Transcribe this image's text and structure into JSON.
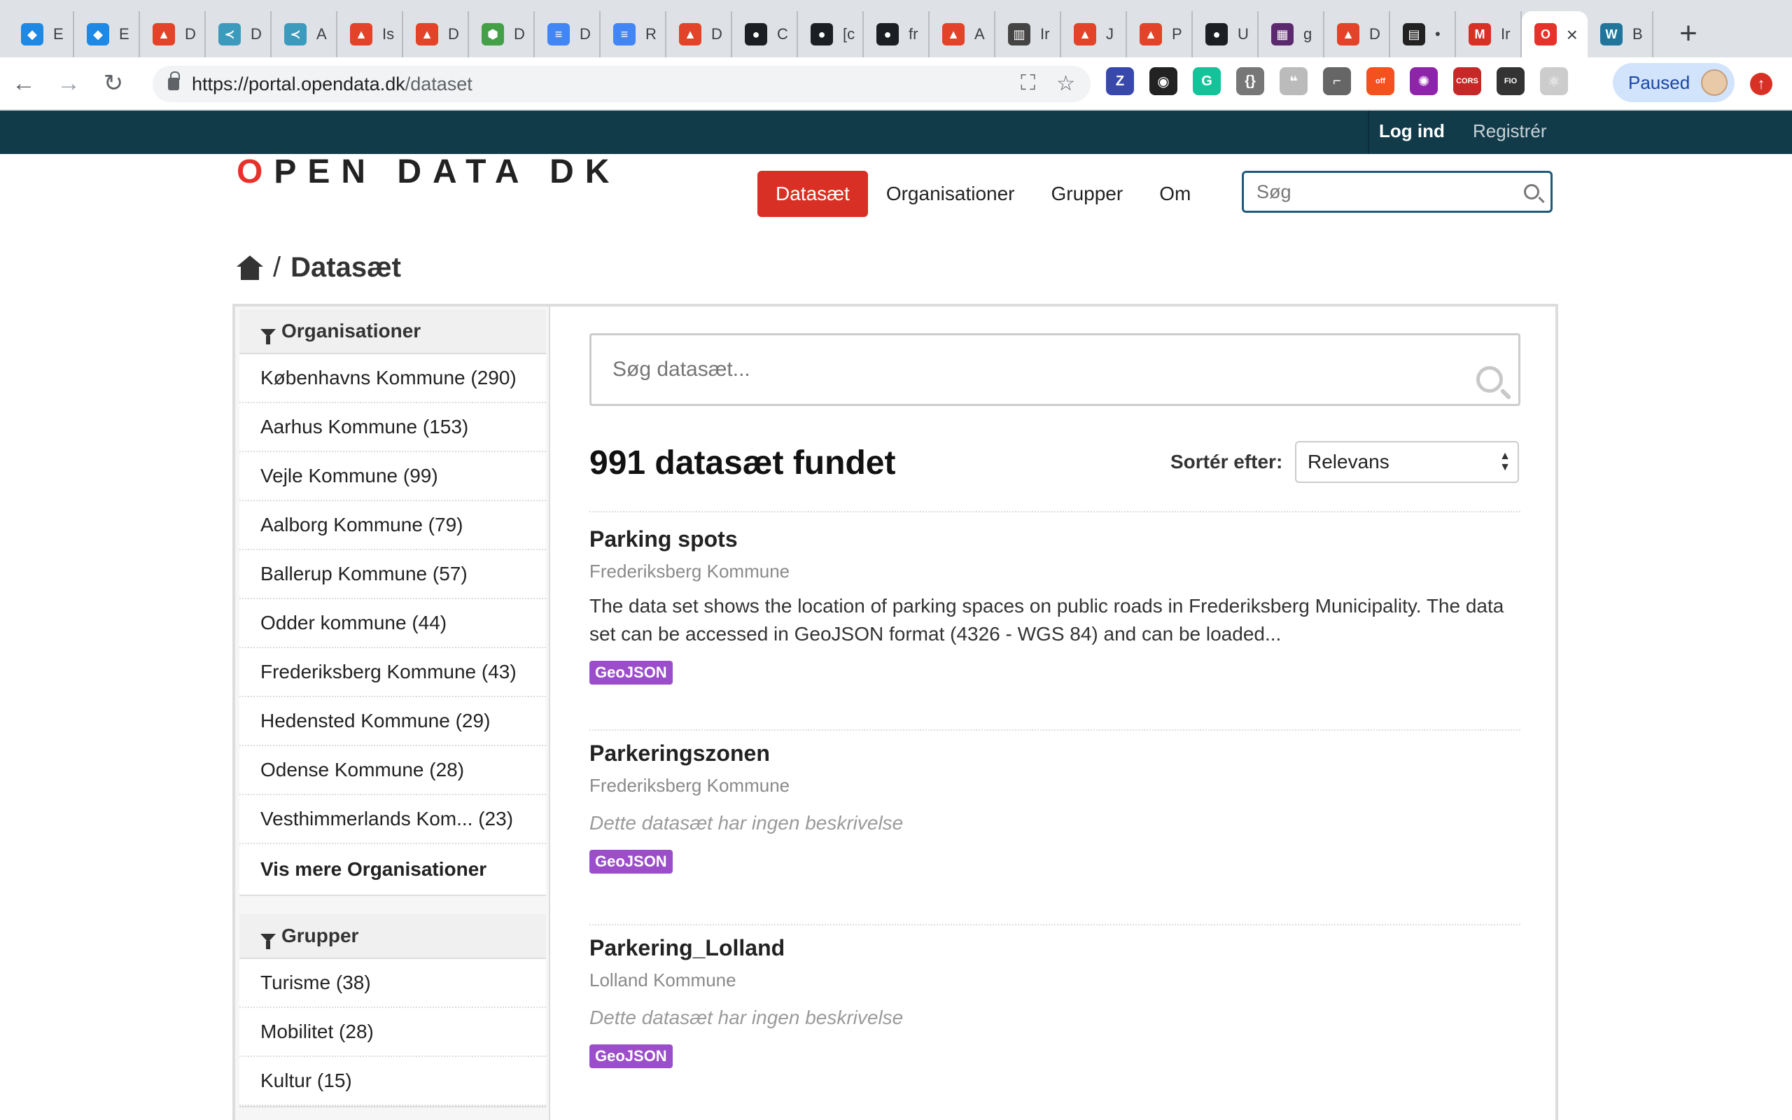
{
  "browser": {
    "tabs": [
      {
        "icon": "vscode-icon",
        "title": "E",
        "color": "#1e88e5",
        "glyph": "◆"
      },
      {
        "icon": "vscode-icon",
        "title": "E",
        "color": "#1e88e5",
        "glyph": "◆"
      },
      {
        "icon": "gitlab-icon",
        "title": "D",
        "color": "#e24329",
        "glyph": "▲"
      },
      {
        "icon": "kite-icon",
        "title": "D",
        "color": "#3c9bbd",
        "glyph": "≺"
      },
      {
        "icon": "kite-icon",
        "title": "A",
        "color": "#3c9bbd",
        "glyph": "≺"
      },
      {
        "icon": "gitlab-icon",
        "title": "Is",
        "color": "#e24329",
        "glyph": "▲"
      },
      {
        "icon": "gitlab-icon",
        "title": "D",
        "color": "#e24329",
        "glyph": "▲"
      },
      {
        "icon": "node-icon",
        "title": "D",
        "color": "#43a047",
        "glyph": "⬢"
      },
      {
        "icon": "google-docs-icon",
        "title": "D",
        "color": "#4285f4",
        "glyph": "≡"
      },
      {
        "icon": "google-docs-icon",
        "title": "R",
        "color": "#4285f4",
        "glyph": "≡"
      },
      {
        "icon": "gitlab-icon",
        "title": "D",
        "color": "#e24329",
        "glyph": "▲"
      },
      {
        "icon": "github-icon",
        "title": "C",
        "color": "#1b1f23",
        "glyph": "●"
      },
      {
        "icon": "github-icon",
        "title": "[c",
        "color": "#1b1f23",
        "glyph": "●"
      },
      {
        "icon": "github-icon",
        "title": "fr",
        "color": "#1b1f23",
        "glyph": "●"
      },
      {
        "icon": "gitlab-icon",
        "title": "A",
        "color": "#e24329",
        "glyph": "▲"
      },
      {
        "icon": "reader-icon",
        "title": "Ir",
        "color": "#444444",
        "glyph": "▥"
      },
      {
        "icon": "gitlab-icon",
        "title": "J",
        "color": "#e24329",
        "glyph": "▲"
      },
      {
        "icon": "gitlab-icon",
        "title": "P",
        "color": "#e24329",
        "glyph": "▲"
      },
      {
        "icon": "github-icon",
        "title": "U",
        "color": "#1b1f23",
        "glyph": "●"
      },
      {
        "icon": "grid-app-icon",
        "title": "g",
        "color": "#5b2a6e",
        "glyph": "▦"
      },
      {
        "icon": "gitlab-icon",
        "title": "D",
        "color": "#e24329",
        "glyph": "▲"
      },
      {
        "icon": "document-icon",
        "title": "•",
        "color": "#222222",
        "glyph": "▤"
      },
      {
        "icon": "gmail-icon",
        "title": "Ir",
        "color": "#d93025",
        "glyph": "M"
      },
      {
        "icon": "opendata-icon",
        "title": "",
        "color": "#e7312b",
        "glyph": "O",
        "active": true
      },
      {
        "icon": "wordpress-icon",
        "title": "B",
        "color": "#21759b",
        "glyph": "W"
      }
    ],
    "address": {
      "origin": "https://portal.opendata.dk",
      "path": "/dataset"
    },
    "extensions": [
      {
        "icon": "z-extension-icon",
        "color": "#3949ab",
        "glyph": "Z"
      },
      {
        "icon": "camera-extension-icon",
        "color": "#222222",
        "glyph": "◉"
      },
      {
        "icon": "grammarly-icon",
        "color": "#15c39a",
        "glyph": "G"
      },
      {
        "icon": "json-extension-icon",
        "color": "#777777",
        "glyph": "{}"
      },
      {
        "icon": "chat-extension-icon",
        "color": "#bbbbbb",
        "glyph": "❝"
      },
      {
        "icon": "paint-roller-icon",
        "color": "#666666",
        "glyph": "⌐"
      },
      {
        "icon": "off-extension-icon",
        "color": "#f4511e",
        "glyph": "off"
      },
      {
        "icon": "color-wheel-icon",
        "color": "#8e24aa",
        "glyph": "✺"
      },
      {
        "icon": "cors-extension-icon",
        "color": "#c62828",
        "glyph": "CORS"
      },
      {
        "icon": "fio-extension-icon",
        "color": "#333333",
        "glyph": "FIO"
      },
      {
        "icon": "react-extension-icon",
        "color": "#cccccc",
        "glyph": "⚛"
      }
    ],
    "profile_label": "Paused"
  },
  "site": {
    "login": "Log ind",
    "register": "Registrér",
    "logo": {
      "first": "O",
      "rest": "PEN DATA DK"
    },
    "nav": [
      "Datasæt",
      "Organisationer",
      "Grupper",
      "Om"
    ],
    "search_placeholder": "Søg",
    "breadcrumb_current": "Datasæt",
    "accent": "#d93025",
    "topbar_color": "#123b4a"
  },
  "sidebar": {
    "organisations_heading": "Organisationer",
    "organisations": [
      "Københavns Kommune (290)",
      "Aarhus Kommune (153)",
      "Vejle Kommune (99)",
      "Aalborg Kommune (79)",
      "Ballerup Kommune (57)",
      "Odder kommune (44)",
      "Frederiksberg Kommune (43)",
      "Hedensted Kommune (29)",
      "Odense Kommune (28)",
      "Vesthimmerlands Kom... (23)"
    ],
    "more_organisations": "Vis mere Organisationer",
    "groups_heading": "Grupper",
    "groups": [
      "Turisme (38)",
      "Mobilitet (28)",
      "Kultur (15)"
    ]
  },
  "results": {
    "search_placeholder": "Søg datasæt...",
    "count_text": "991 datasæt fundet",
    "sort_label": "Sortér efter:",
    "sort_value": "Relevans",
    "items": [
      {
        "title": "Parking spots",
        "org": "Frederiksberg Kommune",
        "description": "The data set shows the location of parking spaces on public roads in Frederiksberg Municipality. The data set can be accessed in GeoJSON format (4326 - WGS 84) and can be loaded...",
        "empty": false,
        "format": "GeoJSON"
      },
      {
        "title": "Parkeringszonen",
        "org": "Frederiksberg Kommune",
        "description": "Dette datasæt har ingen beskrivelse",
        "empty": true,
        "format": "GeoJSON"
      },
      {
        "title": "Parkering_Lolland",
        "org": "Lolland Kommune",
        "description": "Dette datasæt har ingen beskrivelse",
        "empty": true,
        "format": "GeoJSON"
      }
    ],
    "badge_color": "#9b4dca"
  }
}
